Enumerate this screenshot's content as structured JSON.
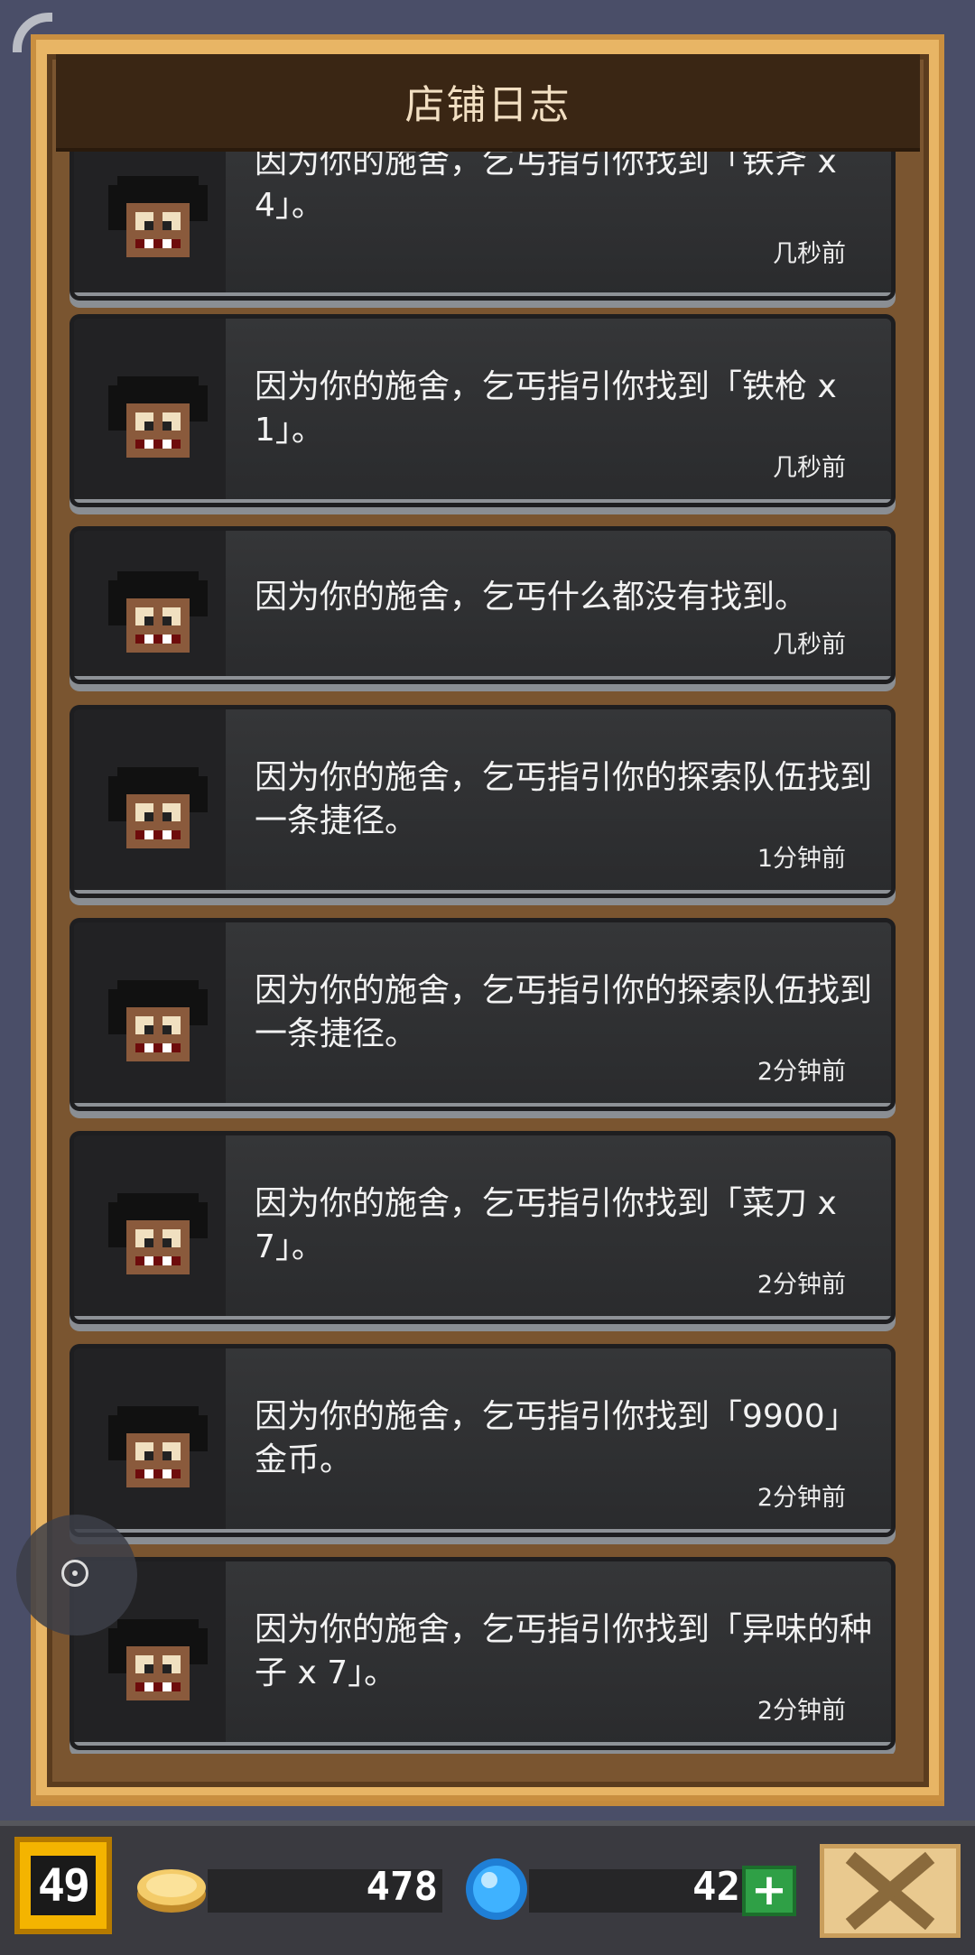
{
  "title": "店铺日志",
  "log_entries": [
    {
      "message": "因为你的施舍，乞丐指引你找到「铁斧 x 4」。",
      "time": "几秒前"
    },
    {
      "message": "因为你的施舍，乞丐指引你找到「铁枪 x 1」。",
      "time": "几秒前"
    },
    {
      "message": "因为你的施舍，乞丐什么都没有找到。",
      "time": "几秒前"
    },
    {
      "message": "因为你的施舍，乞丐指引你的探索队伍找到一条捷径。",
      "time": "1分钟前"
    },
    {
      "message": "因为你的施舍，乞丐指引你的探索队伍找到一条捷径。",
      "time": "2分钟前"
    },
    {
      "message": "因为你的施舍，乞丐指引你找到「菜刀 x 7」。",
      "time": "2分钟前"
    },
    {
      "message": "因为你的施舍，乞丐指引你找到「9900」金币。",
      "time": "2分钟前"
    },
    {
      "message": "因为你的施舍，乞丐指引你找到「异味的种子 x 7」。",
      "time": "2分钟前"
    }
  ],
  "status_bar": {
    "level": "49",
    "gold": "478",
    "gems": "42",
    "plus_label": "+"
  },
  "icons": {
    "avatar": "beggar-avatar-icon",
    "coin": "coin-icon",
    "gem": "gem-icon",
    "close": "close-icon"
  }
}
